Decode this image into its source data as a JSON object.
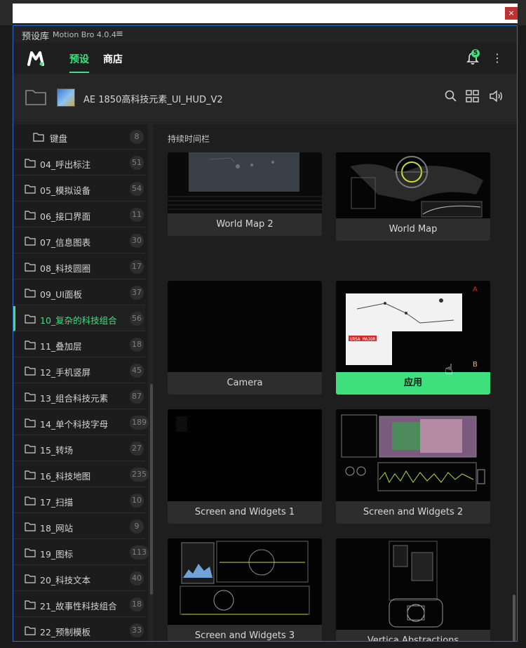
{
  "window": {
    "close_label": "×"
  },
  "title_bar": {
    "title": "预设库",
    "subtitle": "Motion Bro 4.0.4",
    "menu_icon": "≡"
  },
  "nav": {
    "logo": "motion-bro-logo",
    "tabs": [
      {
        "label": "预设",
        "active": true
      },
      {
        "label": "商店",
        "active": false
      }
    ],
    "notification_count": "5",
    "more_icon": "⋮"
  },
  "pack": {
    "name": "AE 1850高科技元素_UI_HUD_V2",
    "tools": [
      "search-icon",
      "grid-view-icon",
      "volume-icon"
    ]
  },
  "sidebar": {
    "items": [
      {
        "label": "键盘",
        "count": "8",
        "sub": true
      },
      {
        "label": "04_呼出标注",
        "count": "51"
      },
      {
        "label": "05_模拟设备",
        "count": "54"
      },
      {
        "label": "06_接口界面",
        "count": "11"
      },
      {
        "label": "07_信息图表",
        "count": "30"
      },
      {
        "label": "08_科技圆圈",
        "count": "17"
      },
      {
        "label": "09_UI面板",
        "count": "37"
      },
      {
        "label": "10_复杂的科技组合",
        "count": "56",
        "active": true
      },
      {
        "label": "11_叠加层",
        "count": "18"
      },
      {
        "label": "12_手机竖屏",
        "count": "45"
      },
      {
        "label": "13_组合科技元素",
        "count": "87"
      },
      {
        "label": "14_单个科技字母",
        "count": "189"
      },
      {
        "label": "15_转场",
        "count": "27"
      },
      {
        "label": "16_科技地图",
        "count": "235"
      },
      {
        "label": "17_扫描",
        "count": "10"
      },
      {
        "label": "18_网站",
        "count": "9"
      },
      {
        "label": "19_图标",
        "count": "113"
      },
      {
        "label": "20_科技文本",
        "count": "40"
      },
      {
        "label": "21_故事性科技组合",
        "count": "18"
      },
      {
        "label": "22_预制模板",
        "count": "33"
      }
    ]
  },
  "content": {
    "section_title": "持续时间栏",
    "cards": [
      {
        "caption": "World Map 2"
      },
      {
        "caption": "World Map"
      },
      {
        "caption": "Camera"
      },
      {
        "caption": "应用",
        "apply": true
      },
      {
        "caption": "Screen and Widgets 1"
      },
      {
        "caption": "Screen and Widgets 2"
      },
      {
        "caption": "Screen and Widgets 3"
      },
      {
        "caption": "Vertica Abstractions"
      }
    ],
    "hud_text": {
      "ursa": "URSA MAJOR",
      "a": "A",
      "b": "B"
    }
  },
  "colors": {
    "accent": "#3ee07e",
    "panel_border": "#2f6cc9",
    "close": "#c13131"
  }
}
